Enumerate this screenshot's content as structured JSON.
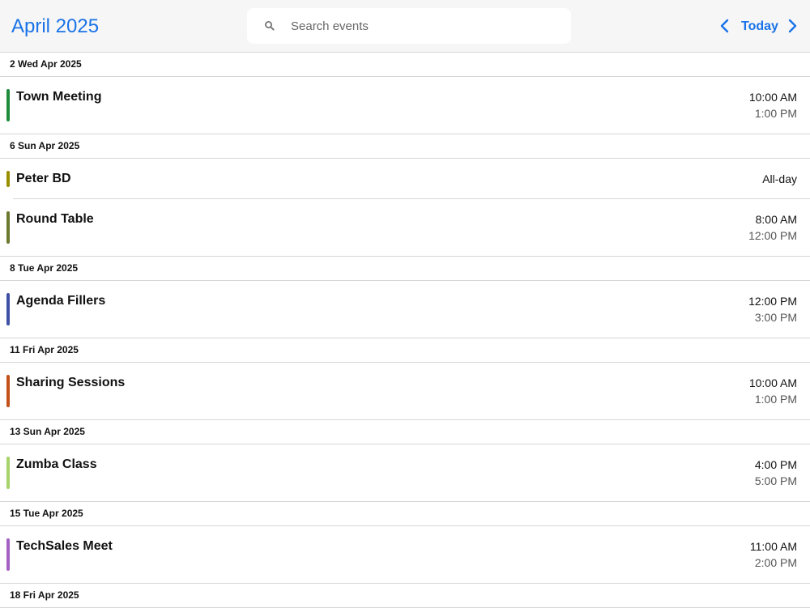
{
  "header": {
    "month_title": "April 2025",
    "search_placeholder": "Search events",
    "search_value": "",
    "today_label": "Today",
    "prev_icon": "chevron-left-icon",
    "next_icon": "chevron-right-icon",
    "accent_color": "#1a73e8"
  },
  "agenda": {
    "days": [
      {
        "label": "2 Wed Apr 2025",
        "events": [
          {
            "title": "Town Meeting",
            "start": "10:00 AM",
            "end": "1:00 PM",
            "color": "#1e8c3a"
          }
        ]
      },
      {
        "label": "6 Sun Apr 2025",
        "events": [
          {
            "title": "Peter BD",
            "start": "All-day",
            "end": "",
            "color": "#9a8f00"
          },
          {
            "title": "Round Table",
            "start": "8:00 AM",
            "end": "12:00 PM",
            "color": "#6b7a2e"
          }
        ]
      },
      {
        "label": "8 Tue Apr 2025",
        "events": [
          {
            "title": "Agenda Fillers",
            "start": "12:00 PM",
            "end": "3:00 PM",
            "color": "#3f51a5"
          }
        ]
      },
      {
        "label": "11 Fri Apr 2025",
        "events": [
          {
            "title": "Sharing Sessions",
            "start": "10:00 AM",
            "end": "1:00 PM",
            "color": "#c4501a"
          }
        ]
      },
      {
        "label": "13 Sun Apr 2025",
        "events": [
          {
            "title": "Zumba Class",
            "start": "4:00 PM",
            "end": "5:00 PM",
            "color": "#a6d36a"
          }
        ]
      },
      {
        "label": "15 Tue Apr 2025",
        "events": [
          {
            "title": "TechSales Meet",
            "start": "11:00 AM",
            "end": "2:00 PM",
            "color": "#a561c2"
          }
        ]
      },
      {
        "label": "18 Fri Apr 2025",
        "events": []
      }
    ]
  }
}
